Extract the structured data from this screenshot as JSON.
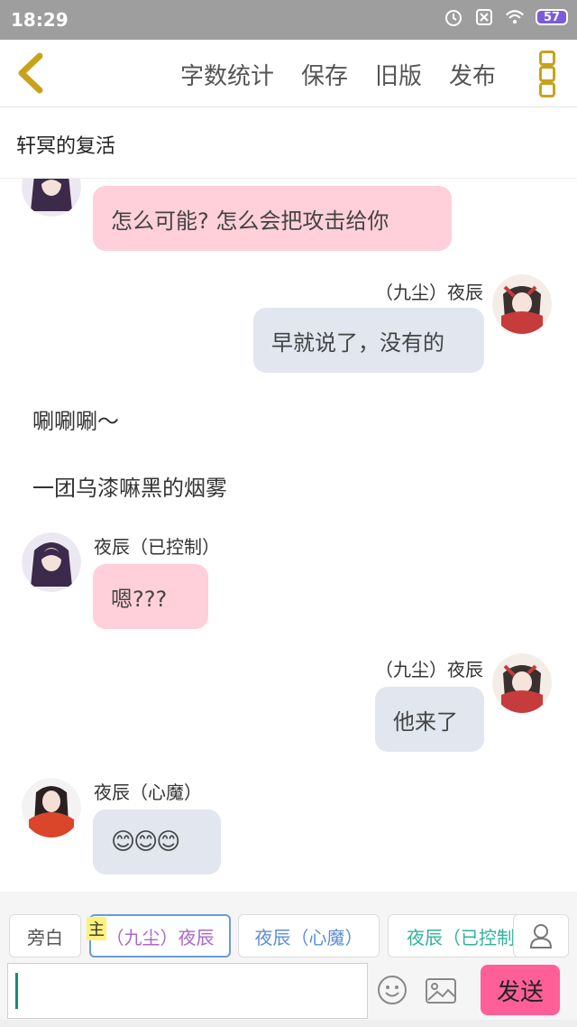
{
  "status_bar": {
    "time": "18:29",
    "battery": "57"
  },
  "toolbar": {
    "actions": [
      "字数统计",
      "保存",
      "旧版",
      "发布"
    ]
  },
  "story": {
    "title": "轩冥的复活"
  },
  "messages": [
    {
      "side": "left",
      "name": "",
      "text": "怎么可能? 怎么会把攻击给你",
      "bubble": "pink"
    },
    {
      "side": "right",
      "name": "（九尘）夜辰",
      "text": "早就说了，没有的",
      "bubble": "gray"
    },
    {
      "type": "narration",
      "text": "唰唰唰～"
    },
    {
      "type": "narration",
      "text": "一团乌漆嘛黑的烟雾"
    },
    {
      "side": "left",
      "name": "夜辰（已控制）",
      "text": "嗯???",
      "bubble": "pink"
    },
    {
      "side": "right",
      "name": "（九尘）夜辰",
      "text": "他来了",
      "bubble": "gray"
    },
    {
      "side": "left",
      "name": "夜辰（心魔）",
      "text": "😊😊😊",
      "bubble": "gray"
    }
  ],
  "roles": {
    "host_badge": "主",
    "items": [
      {
        "label": "旁白",
        "color": "#555555"
      },
      {
        "label": "（九尘）夜辰",
        "color": "#a968c9"
      },
      {
        "label": "夜辰（心魔）",
        "color": "#5b8fd6"
      },
      {
        "label": "夜辰（已控制",
        "color": "#2fb39a"
      }
    ]
  },
  "composer": {
    "value": "",
    "send_label": "发送"
  },
  "colors": {
    "accent_send": "#ff5f97",
    "bubble_pink": "#ffd0da",
    "bubble_gray": "#e1e6ef"
  }
}
